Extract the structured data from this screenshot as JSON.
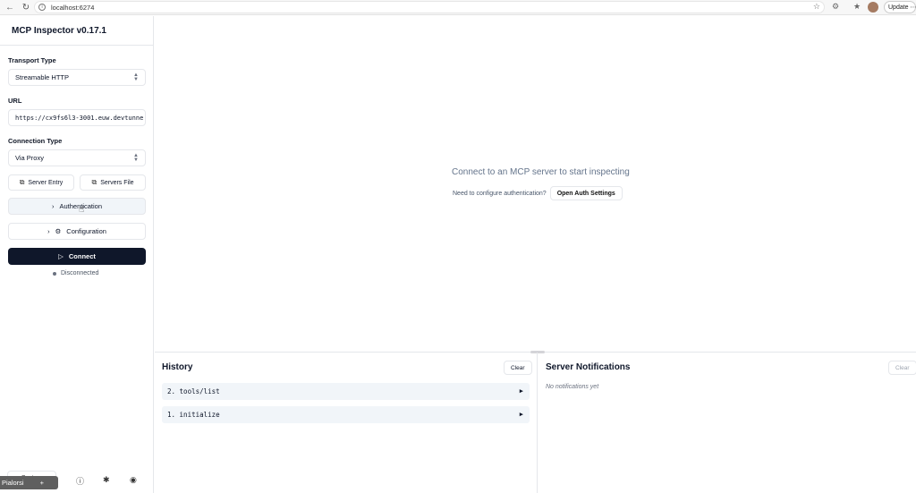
{
  "browser": {
    "url": "localhost:6274",
    "update_label": "Update",
    "more_label": "⋯"
  },
  "sidebar": {
    "title": "MCP Inspector v0.17.1",
    "transport_label": "Transport Type",
    "transport_value": "Streamable HTTP",
    "url_label": "URL",
    "url_value": "https://cx9fs6l3-3001.euw.devtunne",
    "connection_label": "Connection Type",
    "connection_value": "Via Proxy",
    "server_entry_label": "Server Entry",
    "servers_file_label": "Servers File",
    "authentication_label": "Authentication",
    "configuration_label": "Configuration",
    "connect_label": "Connect",
    "status_text": "Disconnected",
    "system_label": "System"
  },
  "main": {
    "prompt": "Connect to an MCP server to start inspecting",
    "auth_question": "Need to configure authentication?",
    "auth_button": "Open Auth Settings"
  },
  "history": {
    "title": "History",
    "clear_label": "Clear",
    "items": [
      "2. tools/list",
      "1. initialize"
    ]
  },
  "notifications": {
    "title": "Server Notifications",
    "clear_label": "Clear",
    "empty_text": "No notifications yet"
  },
  "taskbar": {
    "label": "Pialorsi",
    "add": "+"
  },
  "colors": {
    "primary": "#0f172a",
    "row_bg": "#f1f5f9",
    "border": "#e5e7eb"
  }
}
